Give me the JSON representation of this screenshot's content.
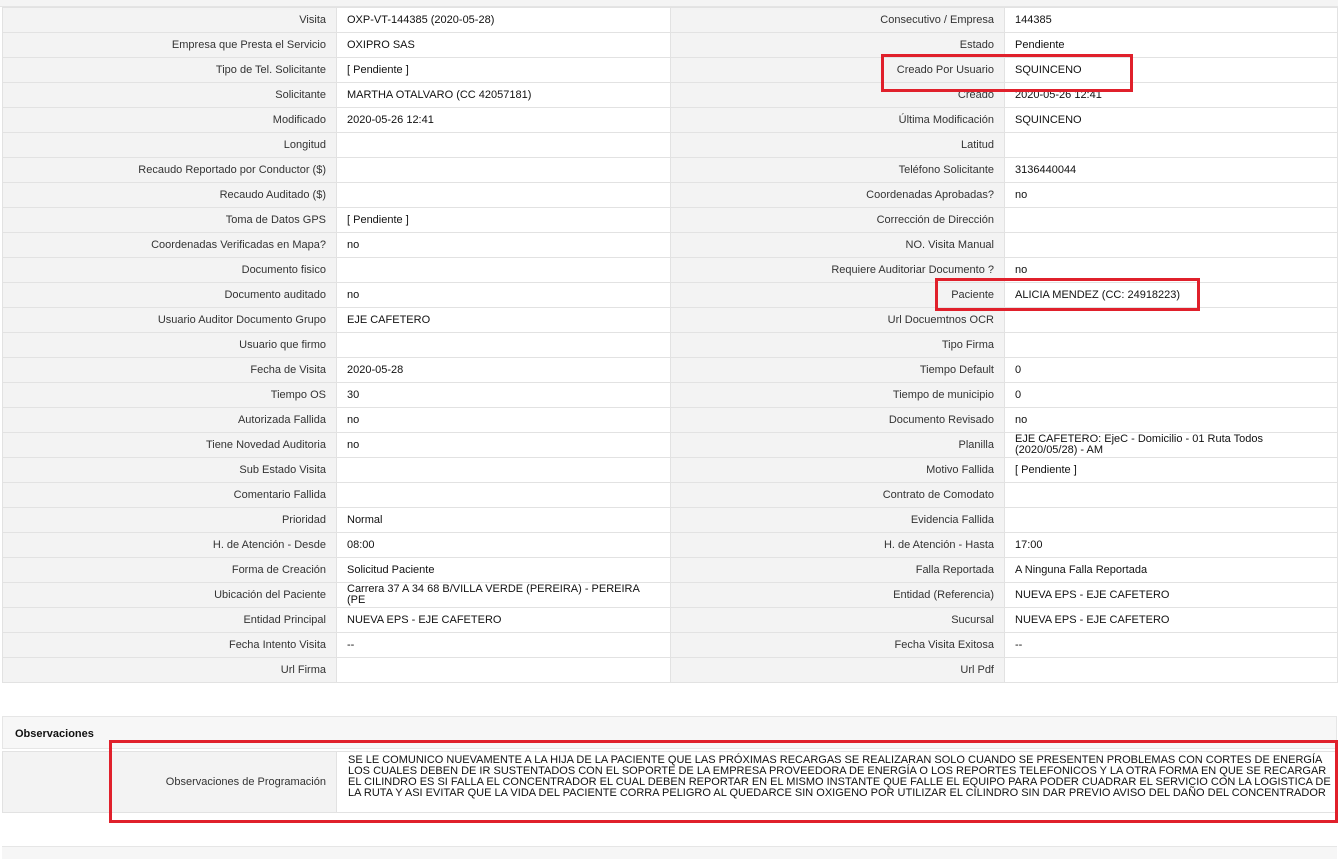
{
  "rows": [
    {
      "l1": "Visita",
      "v1": "OXP-VT-144385 (2020-05-28)",
      "l2": "Consecutivo / Empresa",
      "v2": "144385"
    },
    {
      "l1": "Empresa que Presta el Servicio",
      "v1": "OXIPRO SAS",
      "l2": "Estado",
      "v2": "Pendiente"
    },
    {
      "l1": "Tipo de Tel. Solicitante",
      "v1": "[ Pendiente ]",
      "l2": "Creado Por Usuario",
      "v2": "SQUINCENO"
    },
    {
      "l1": "Solicitante",
      "v1": "MARTHA OTALVARO (CC 42057181)",
      "l2": "Creado",
      "v2": "2020-05-26 12:41"
    },
    {
      "l1": "Modificado",
      "v1": "2020-05-26 12:41",
      "l2": "Última Modificación",
      "v2": " SQUINCENO"
    },
    {
      "l1": "Longitud",
      "v1": "",
      "l2": "Latitud",
      "v2": ""
    },
    {
      "l1": "Recaudo Reportado por Conductor ($)",
      "v1": "",
      "l2": "Teléfono Solicitante",
      "v2": "3136440044"
    },
    {
      "l1": "Recaudo Auditado ($)",
      "v1": "",
      "l2": "Coordenadas Aprobadas?",
      "v2": " no"
    },
    {
      "l1": "Toma de Datos GPS",
      "v1": "[ Pendiente ]",
      "l2": "Corrección de Dirección",
      "v2": ""
    },
    {
      "l1": "Coordenadas Verificadas en Mapa?",
      "v1": " no",
      "l2": "NO. Visita Manual",
      "v2": ""
    },
    {
      "l1": "Documento fisico",
      "v1": "",
      "l2": "Requiere Auditoriar Documento ?",
      "v2": " no"
    },
    {
      "l1": "Documento auditado",
      "v1": " no",
      "l2": "Paciente",
      "v2": "ALICIA MENDEZ (CC: 24918223)"
    },
    {
      "l1": "Usuario Auditor Documento Grupo",
      "v1": "EJE CAFETERO",
      "l2": "Url Docuemtnos OCR",
      "v2": ""
    },
    {
      "l1": "Usuario que firmo",
      "v1": "",
      "l2": "Tipo Firma",
      "v2": ""
    },
    {
      "l1": "Fecha de Visita",
      "v1": " 2020-05-28",
      "l2": "Tiempo Default",
      "v2": " 0"
    },
    {
      "l1": "Tiempo OS",
      "v1": "30",
      "l2": "Tiempo de municipio",
      "v2": " 0"
    },
    {
      "l1": "Autorizada Fallida",
      "v1": " no",
      "l2": "Documento Revisado",
      "v2": " no"
    },
    {
      "l1": "Tiene Novedad Auditoria",
      "v1": " no",
      "l2": "Planilla",
      "v2": "EJE CAFETERO: EjeC - Domicilio - 01 Ruta Todos (2020/05/28) - AM"
    },
    {
      "l1": "Sub Estado Visita",
      "v1": "",
      "l2": "Motivo Fallida",
      "v2": "[ Pendiente ]"
    },
    {
      "l1": "Comentario Fallida",
      "v1": "",
      "l2": "Contrato de Comodato",
      "v2": ""
    },
    {
      "l1": "Prioridad",
      "v1": "Normal",
      "l2": "Evidencia Fallida",
      "v2": ""
    },
    {
      "l1": "H. de Atención - Desde",
      "v1": "08:00",
      "l2": "H. de Atención - Hasta",
      "v2": "17:00"
    },
    {
      "l1": "Forma de Creación",
      "v1": "Solicitud Paciente",
      "l2": "Falla Reportada",
      "v2": "A Ninguna Falla Reportada"
    },
    {
      "l1": "Ubicación del Paciente",
      "v1": "Carrera 37 A 34 68 B/VILLA VERDE (PEREIRA) - PEREIRA (PE",
      "l2": "Entidad (Referencia)",
      "v2": "NUEVA EPS - EJE CAFETERO"
    },
    {
      "l1": "Entidad Principal",
      "v1": "NUEVA EPS - EJE CAFETERO",
      "l2": "Sucursal",
      "v2": "NUEVA EPS - EJE CAFETERO"
    },
    {
      "l1": "Fecha Intento Visita",
      "v1": "--",
      "l2": "Fecha Visita Exitosa",
      "v2": " --"
    },
    {
      "l1": "Url Firma",
      "v1": "",
      "l2": "Url Pdf",
      "v2": ""
    }
  ],
  "observaciones": {
    "title": "Observaciones",
    "label": "Observaciones de Programación",
    "text": "  SE LE COMUNICO NUEVAMENTE A LA HIJA DE LA PACIENTE QUE LAS PRÓXIMAS RECARGAS SE REALIZARAN SOLO CUANDO SE PRESENTEN PROBLEMAS CON CORTES DE ENERGÍA LOS CUALES DEBEN DE IR SUSTENTADOS CON EL SOPORTE DE LA EMPRESA PROVEEDORA DE ENERGÍA O LOS REPORTES TELEFONICOS Y LA OTRA FORMA EN QUE SE RECARGAR EL CILINDRO ES SI FALLA EL CONCENTRADOR EL CUAL DEBEN REPORTAR EN EL MISMO INSTANTE QUE FALLE EL EQUIPO PARA PODER CUADRAR EL SERVICIO CON LA LOGISTICA DE LA RUTA Y ASI EVITAR QUE LA VIDA DEL PACIENTE CORRA PELIGRO AL QUEDARCE SIN OXIGENO POR UTILIZAR EL CILINDRO SIN DAR PREVIO AVISO DEL DAÑO DEL CONCENTRADOR"
  },
  "colors": {
    "highlight": "#e0202b",
    "label_bg": "#f3f3f3",
    "border": "#e2e2e2"
  }
}
